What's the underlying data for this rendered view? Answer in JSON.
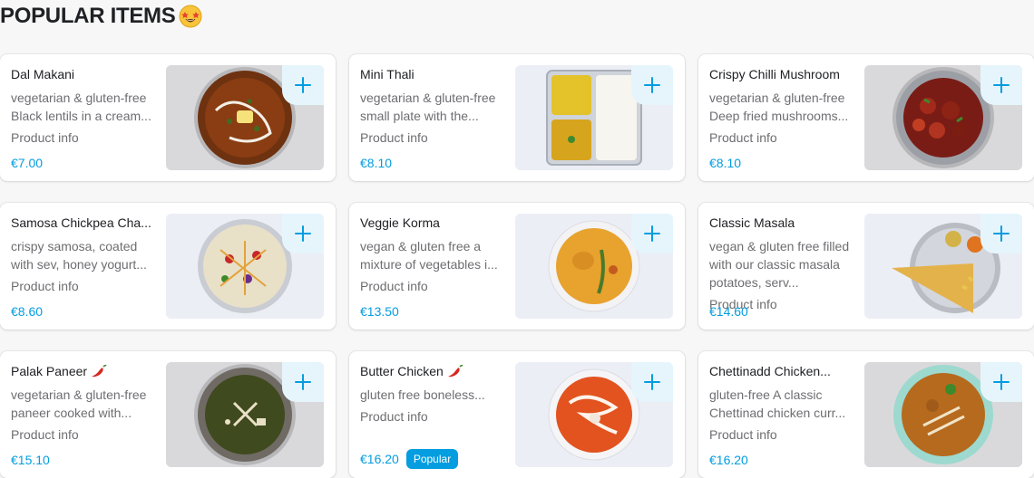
{
  "section": {
    "title": "POPULAR ITEMS"
  },
  "items": [
    {
      "name": "Dal Makani",
      "desc": "vegetarian & gluten-free Black lentils in a cream...",
      "info": "Product info",
      "price": "€7.00",
      "spicy": false,
      "badge": "",
      "food": "dal"
    },
    {
      "name": "Mini Thali",
      "desc": "vegetarian & gluten-free small plate with the...",
      "info": "Product info",
      "price": "€8.10",
      "spicy": false,
      "badge": "",
      "food": "thali"
    },
    {
      "name": "Crispy Chilli Mushroom",
      "desc": "vegetarian & gluten-free Deep fried mushrooms...",
      "info": "Product info",
      "price": "€8.10",
      "spicy": false,
      "badge": "",
      "food": "mushroom"
    },
    {
      "name": "Samosa Chickpea Cha...",
      "desc": "crispy samosa, coated with sev, honey yogurt...",
      "info": "Product info",
      "price": "€8.60",
      "spicy": false,
      "badge": "",
      "food": "chaat"
    },
    {
      "name": "Veggie Korma",
      "desc": "vegan & gluten free a mixture of vegetables i...",
      "info": "Product info",
      "price": "€13.50",
      "spicy": false,
      "badge": "",
      "food": "korma"
    },
    {
      "name": "Classic Masala",
      "desc": "vegan & gluten free filled with our classic masala potatoes, serv...",
      "info": "Product info",
      "price": "€14.60",
      "spicy": false,
      "badge": "",
      "food": "dosa",
      "three": true
    },
    {
      "name": "Palak Paneer",
      "desc": "vegetarian & gluten-free paneer cooked with...",
      "info": "Product info",
      "price": "€15.10",
      "spicy": true,
      "badge": "",
      "food": "palak"
    },
    {
      "name": "Butter Chicken",
      "desc": "gluten free boneless...",
      "info": "Product info",
      "price": "€16.20",
      "spicy": true,
      "badge": "Popular",
      "food": "butter"
    },
    {
      "name": "Chettinadd Chicken...",
      "desc": "gluten-free A classic Chettinad chicken curr...",
      "info": "Product info",
      "price": "€16.20",
      "spicy": false,
      "badge": "",
      "food": "chettinad"
    }
  ],
  "colors": {
    "accent": "#039de0",
    "accent_light": "#e6f5fc",
    "text": "#202125",
    "muted": "#6e6e72"
  },
  "icons": {
    "add": "plus-icon",
    "spicy": "chili-pepper-icon",
    "title_emoji": "star-struck-emoji-icon"
  }
}
